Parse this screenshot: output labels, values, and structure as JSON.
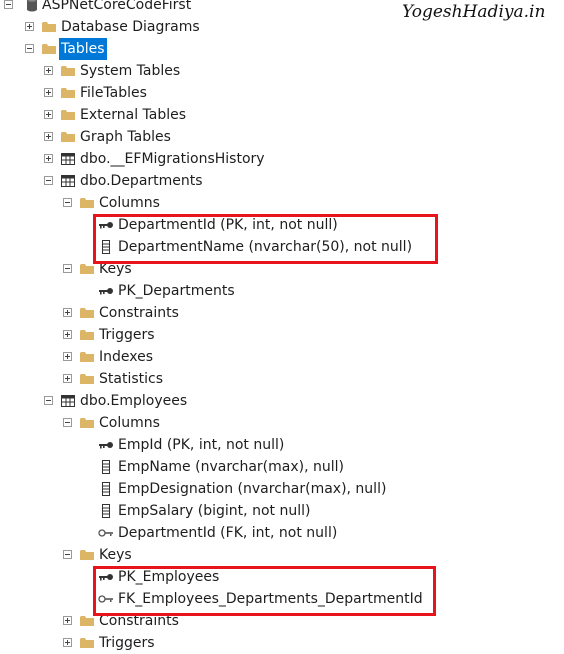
{
  "watermark": "YogeshHadiya.in",
  "highlight_color": "#e8141b",
  "selection_color": "#0078d7",
  "tree": {
    "database": {
      "label": "ASPNetCoreCodeFirst",
      "icon": "database-icon"
    },
    "database_diagrams": {
      "label": "Database Diagrams",
      "icon": "folder-icon"
    },
    "tables": {
      "label": "Tables",
      "icon": "folder-icon",
      "selected": true
    },
    "system_tables": {
      "label": "System Tables"
    },
    "file_tables": {
      "label": "FileTables"
    },
    "external_tables": {
      "label": "External Tables"
    },
    "graph_tables": {
      "label": "Graph Tables"
    },
    "ef_history": {
      "label": "dbo.__EFMigrationsHistory",
      "icon": "table-icon"
    },
    "departments": {
      "label": "dbo.Departments",
      "icon": "table-icon",
      "columns_label": "Columns",
      "columns": [
        {
          "label": "DepartmentId (PK, int, not null)",
          "icon": "primary-key-icon"
        },
        {
          "label": "DepartmentName (nvarchar(50), not null)",
          "icon": "column-icon"
        }
      ],
      "keys_label": "Keys",
      "keys": [
        {
          "label": "PK_Departments",
          "icon": "primary-key-icon"
        }
      ],
      "constraints_label": "Constraints",
      "triggers_label": "Triggers",
      "indexes_label": "Indexes",
      "statistics_label": "Statistics"
    },
    "employees": {
      "label": "dbo.Employees",
      "icon": "table-icon",
      "columns_label": "Columns",
      "columns": [
        {
          "label": "EmpId (PK, int, not null)",
          "icon": "primary-key-icon"
        },
        {
          "label": "EmpName (nvarchar(max), null)",
          "icon": "column-icon"
        },
        {
          "label": "EmpDesignation (nvarchar(max), null)",
          "icon": "column-icon"
        },
        {
          "label": "EmpSalary (bigint, not null)",
          "icon": "column-icon"
        },
        {
          "label": "DepartmentId (FK, int, not null)",
          "icon": "foreign-key-icon"
        }
      ],
      "keys_label": "Keys",
      "keys": [
        {
          "label": "PK_Employees",
          "icon": "primary-key-icon"
        },
        {
          "label": "FK_Employees_Departments_DepartmentId",
          "icon": "foreign-key-icon"
        }
      ],
      "constraints_label": "Constraints",
      "triggers_label": "Triggers"
    }
  }
}
